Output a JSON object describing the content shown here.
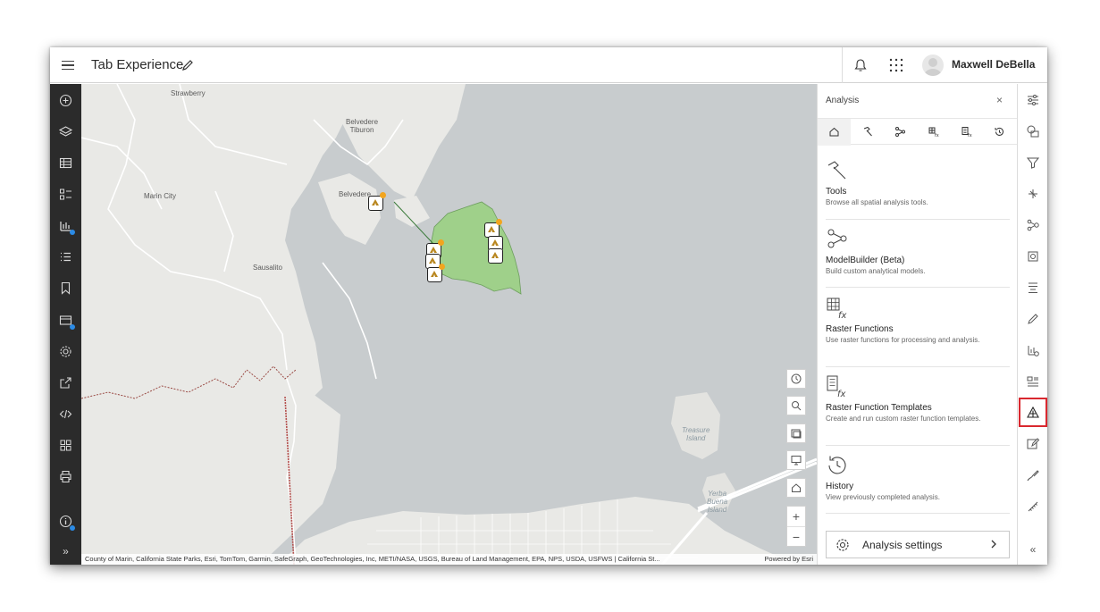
{
  "header": {
    "title": "Tab Experience",
    "user_name": "Maxwell DeBella"
  },
  "map": {
    "labels": {
      "strawberry": "Strawberry",
      "belvedere_tiburon": "Belvedere\nTiburon",
      "marin_city": "Marin City",
      "belvedere": "Belvedere",
      "sausalito": "Sausalito",
      "treasure_island": "Treasure\nIsland",
      "yerba_buena": "Yerba\nBuena\nIsland"
    },
    "attribution": "County of Marin, California State Parks, Esri, TomTom, Garmin, SafeGraph, GeoTechnologies, Inc, METI/NASA, USGS, Bureau of Land Management, EPA, NPS, USDA, USFWS | California St...",
    "powered_by": "Powered by Esri",
    "zoom_in": "+",
    "zoom_out": "−"
  },
  "panel": {
    "title": "Analysis",
    "close": "×",
    "cards": [
      {
        "title": "Tools",
        "desc": "Browse all spatial analysis tools."
      },
      {
        "title": "ModelBuilder (Beta)",
        "desc": "Build custom analytical models."
      },
      {
        "title": "Raster Functions",
        "desc": "Use raster functions for processing and analysis."
      },
      {
        "title": "Raster Function Templates",
        "desc": "Create and run custom raster function templates."
      },
      {
        "title": "History",
        "desc": "View previously completed analysis."
      }
    ],
    "settings_label": "Analysis settings"
  },
  "right_bar": {
    "collapse": "«"
  },
  "left_bar": {
    "expand": "»"
  },
  "colors": {
    "left_bar_bg": "#2b2b2b",
    "highlight": "#d9282f",
    "marker_accent": "#f2a51e",
    "park_fill": "#9fd08a",
    "water": "#c8ccce"
  }
}
